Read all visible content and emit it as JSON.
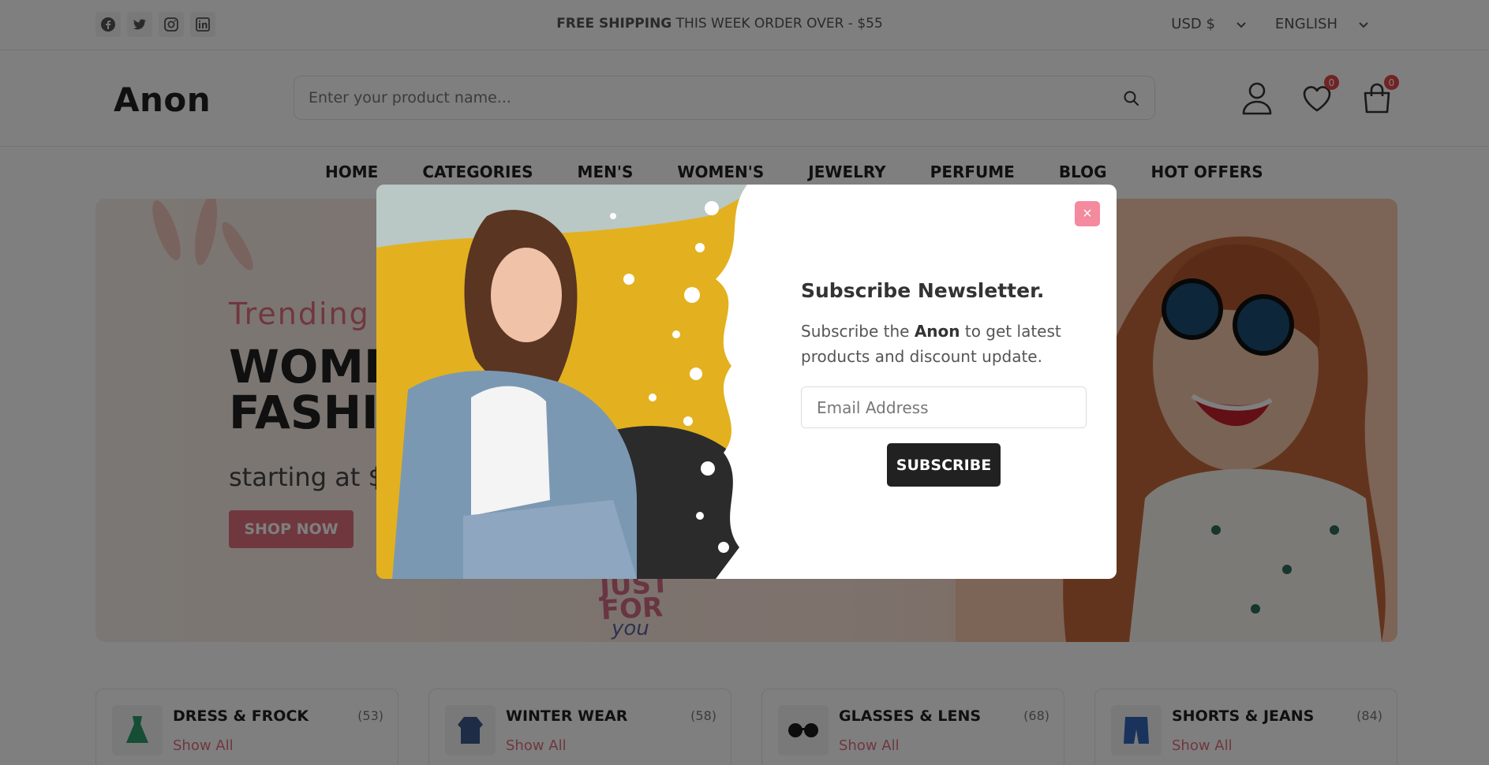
{
  "topbar": {
    "social": [
      {
        "icon": "facebook-icon"
      },
      {
        "icon": "twitter-icon"
      },
      {
        "icon": "instagram-icon"
      },
      {
        "icon": "linkedin-icon"
      }
    ],
    "shipping_bold": "FREE SHIPPING",
    "shipping_rest": " THIS WEEK ORDER OVER - $55",
    "currency": "USD $",
    "language": "ENGLISH"
  },
  "header": {
    "logo": "Anon",
    "search_placeholder": "Enter your product name...",
    "wishlist_count": "0",
    "cart_count": "0"
  },
  "nav": {
    "items": [
      "HOME",
      "CATEGORIES",
      "MEN'S",
      "WOMEN'S",
      "JEWELRY",
      "PERFUME",
      "BLOG",
      "HOT OFFERS"
    ]
  },
  "hero": {
    "subtitle": "Trending",
    "title_line1": "WOME",
    "title_line2": "FASHIO",
    "price": "starting at $",
    "button": "SHOP NOW",
    "badge_line1": "JUST",
    "badge_line2": "FOR",
    "badge_line3": "you"
  },
  "categories": [
    {
      "name": "DRESS & FROCK",
      "count": "(53)",
      "link": "Show All"
    },
    {
      "name": "WINTER WEAR",
      "count": "(58)",
      "link": "Show All"
    },
    {
      "name": "GLASSES & LENS",
      "count": "(68)",
      "link": "Show All"
    },
    {
      "name": "SHORTS & JEANS",
      "count": "(84)",
      "link": "Show All"
    }
  ],
  "modal": {
    "close": "×",
    "title": "Subscribe Newsletter.",
    "desc_pre": "Subscribe the ",
    "desc_brand": "Anon",
    "desc_post": " to get latest products and discount update.",
    "email_placeholder": "Email Address",
    "button": "SUBSCRIBE"
  },
  "colors": {
    "accent": "#e06e7f",
    "dark": "#212121",
    "badge": "#e2474a"
  }
}
